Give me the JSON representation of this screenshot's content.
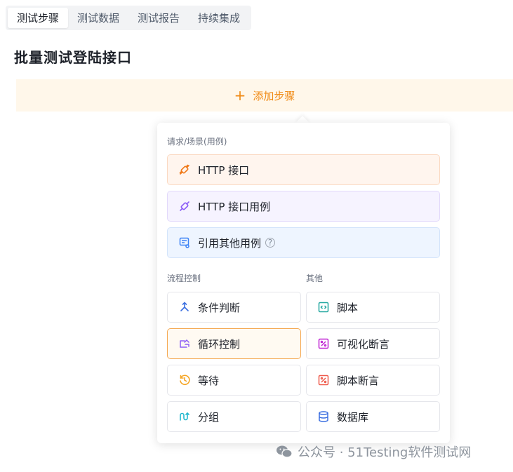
{
  "tabs": [
    {
      "label": "测试步骤",
      "active": true
    },
    {
      "label": "测试数据",
      "active": false
    },
    {
      "label": "测试报告",
      "active": false
    },
    {
      "label": "持续集成",
      "active": false
    }
  ],
  "page": {
    "title": "批量测试登陆接口"
  },
  "add_step": {
    "label": "添加步骤",
    "color": "#f08a14"
  },
  "popover": {
    "request_section": {
      "title": "请求/场景(用例)",
      "items": [
        {
          "label": "HTTP 接口",
          "icon": "link-icon"
        },
        {
          "label": "HTTP 接口用例",
          "icon": "link-icon"
        },
        {
          "label": "引用其他用例",
          "icon": "reference-case-icon",
          "help": "?"
        }
      ]
    },
    "flow_section": {
      "title": "流程控制",
      "items": [
        {
          "label": "条件判断",
          "icon": "branch-icon"
        },
        {
          "label": "循环控制",
          "icon": "loop-icon"
        },
        {
          "label": "等待",
          "icon": "clock-icon"
        },
        {
          "label": "分组",
          "icon": "group-icon"
        }
      ]
    },
    "other_section": {
      "title": "其他",
      "items": [
        {
          "label": "脚本",
          "icon": "script-icon"
        },
        {
          "label": "可视化断言",
          "icon": "assert-icon"
        },
        {
          "label": "脚本断言",
          "icon": "assert-icon"
        },
        {
          "label": "数据库",
          "icon": "database-icon"
        }
      ]
    }
  },
  "watermark": {
    "text": "公众号 · 51Testing软件测试网"
  }
}
